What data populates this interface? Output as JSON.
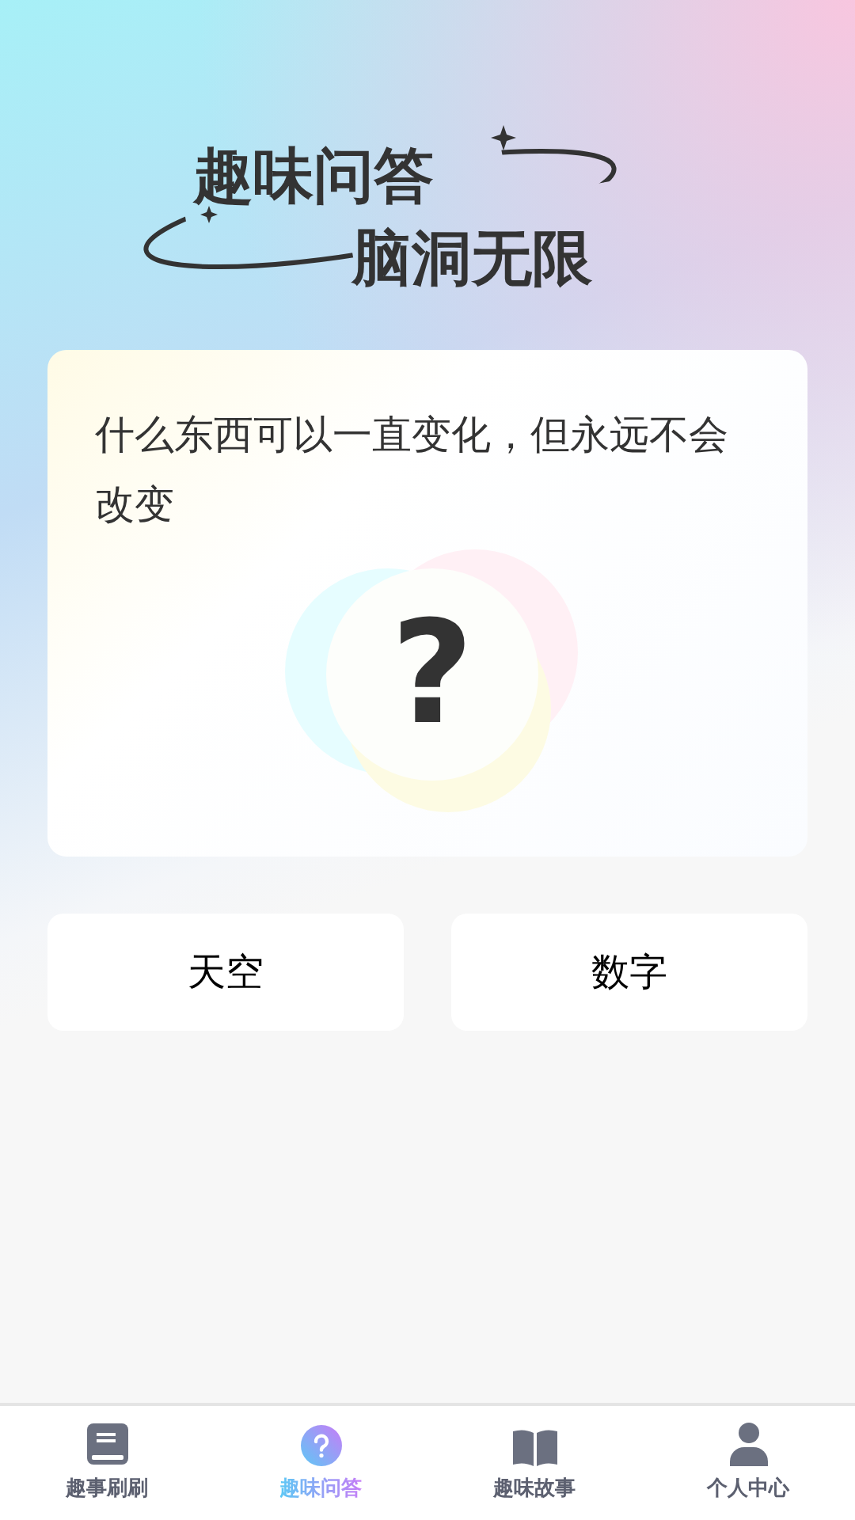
{
  "logo": {
    "line_1": "趣味问答",
    "line_2": "脑洞无限"
  },
  "question": {
    "text": "什么东西可以一直变化，但永远不会改变",
    "mark": "?"
  },
  "answers": [
    {
      "label": "天空",
      "selected": false
    },
    {
      "label": "数字",
      "selected": false
    }
  ],
  "nav": [
    {
      "label": "趣事刷刷",
      "selected": false
    },
    {
      "label": "趣味问答",
      "selected": true
    },
    {
      "label": "趣味故事",
      "selected": false
    },
    {
      "label": "个人中心",
      "selected": false
    }
  ]
}
